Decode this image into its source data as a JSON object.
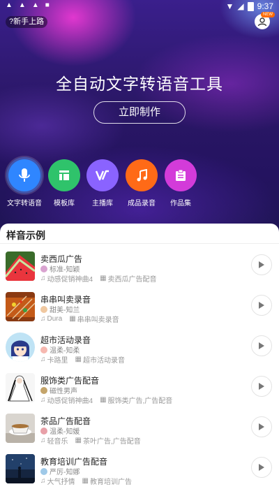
{
  "status": {
    "time": "9:37",
    "left_icons": [
      "warning-icon",
      "warning-icon",
      "warning-icon",
      "notification-icon"
    ]
  },
  "header": {
    "newbie_label": "?新手上路",
    "new_badge": "NEW"
  },
  "hero": {
    "title": "全自动文字转语音工具",
    "make_button": "立即制作"
  },
  "tools": [
    {
      "label": "文字转语音",
      "icon": "microphone-icon",
      "color": "#2f86ff"
    },
    {
      "label": "模板库",
      "icon": "template-icon",
      "color": "#2fc36b"
    },
    {
      "label": "主播库",
      "icon": "anchor-icon",
      "color": "#8a63ff"
    },
    {
      "label": "成品录音",
      "icon": "music-note-icon",
      "color": "#ff6a17"
    },
    {
      "label": "作品集",
      "icon": "clipboard-icon",
      "color": "#d33bd9"
    }
  ],
  "samples": {
    "title": "样音示例",
    "items": [
      {
        "title": "卖西瓜广告",
        "voice": "标准-知颖",
        "music": "动感促销神曲4",
        "tag": "卖西瓜广告配音"
      },
      {
        "title": "串串叫卖录音",
        "voice": "甜美-知兰",
        "music": "Dura",
        "tag": "串串叫卖录音"
      },
      {
        "title": "超市活动录音",
        "voice": "温柔-知柔",
        "music": "卡路里",
        "tag": "超市活动录音"
      },
      {
        "title": "服饰类广告配音",
        "voice": "磁性男声",
        "music": "动感促销神曲4",
        "tag": "服饰类广告,广告配音"
      },
      {
        "title": "茶品广告配音",
        "voice": "温柔-知媛",
        "music": "轻音乐",
        "tag": "茶叶广告,广告配音"
      },
      {
        "title": "教育培训广告配音",
        "voice": "严厉-知娜",
        "music": "大气抒情",
        "tag": "教育培训广告"
      }
    ]
  }
}
